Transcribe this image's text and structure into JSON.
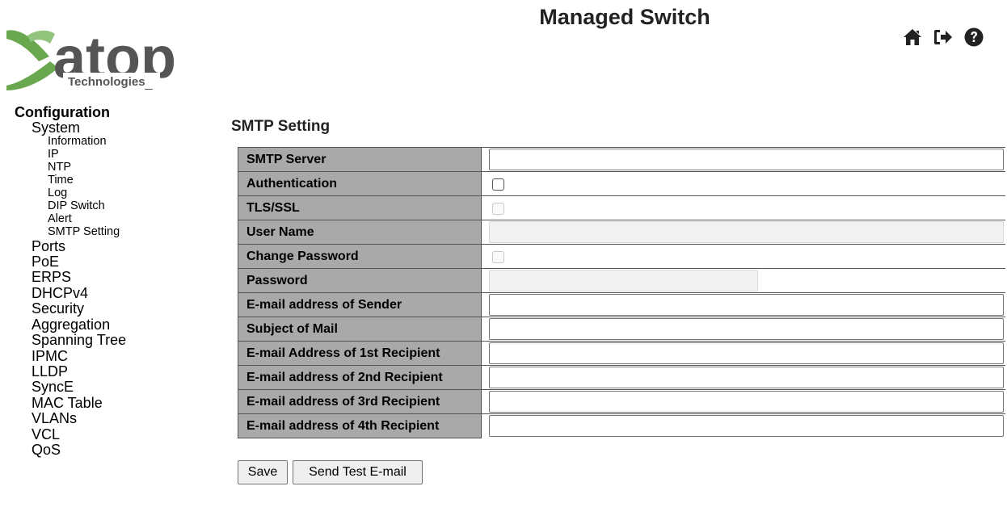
{
  "header": {
    "title": "Managed Switch",
    "logo_text": "atop",
    "logo_sub": "Technologies",
    "icons": [
      "home-icon",
      "logout-icon",
      "help-icon"
    ]
  },
  "nav": {
    "category": "Configuration",
    "system": "System",
    "system_items": [
      "Information",
      "IP",
      "NTP",
      "Time",
      "Log",
      "DIP Switch",
      "Alert",
      "SMTP Setting"
    ],
    "items": [
      "Ports",
      "PoE",
      "ERPS",
      "DHCPv4",
      "Security",
      "Aggregation",
      "Spanning Tree",
      "IPMC",
      "LLDP",
      "SyncE",
      "MAC Table",
      "VLANs",
      "VCL",
      "QoS"
    ]
  },
  "page": {
    "heading": "SMTP Setting",
    "rows": [
      {
        "label": "SMTP Server",
        "type": "text",
        "value": ""
      },
      {
        "label": "Authentication",
        "type": "checkbox",
        "checked": false
      },
      {
        "label": "TLS/SSL",
        "type": "checkbox-disabled",
        "checked": false
      },
      {
        "label": "User Name",
        "type": "text-disabled",
        "value": ""
      },
      {
        "label": "Change Password",
        "type": "checkbox-disabled",
        "checked": false
      },
      {
        "label": "Password",
        "type": "password-disabled",
        "value": ""
      },
      {
        "label": "E-mail address of Sender",
        "type": "text",
        "value": ""
      },
      {
        "label": "Subject of Mail",
        "type": "text",
        "value": ""
      },
      {
        "label": "E-mail Address of 1st Recipient",
        "type": "text",
        "value": ""
      },
      {
        "label": "E-mail address of 2nd Recipient",
        "type": "text",
        "value": ""
      },
      {
        "label": "E-mail address of 3rd Recipient",
        "type": "text",
        "value": ""
      },
      {
        "label": "E-mail address of 4th Recipient",
        "type": "text",
        "value": ""
      }
    ],
    "save_label": "Save",
    "test_label": "Send Test E-mail"
  },
  "colors": {
    "logo_green": "#6aa84f",
    "logo_dark": "#555555",
    "label_bg": "#a9a9a9"
  }
}
